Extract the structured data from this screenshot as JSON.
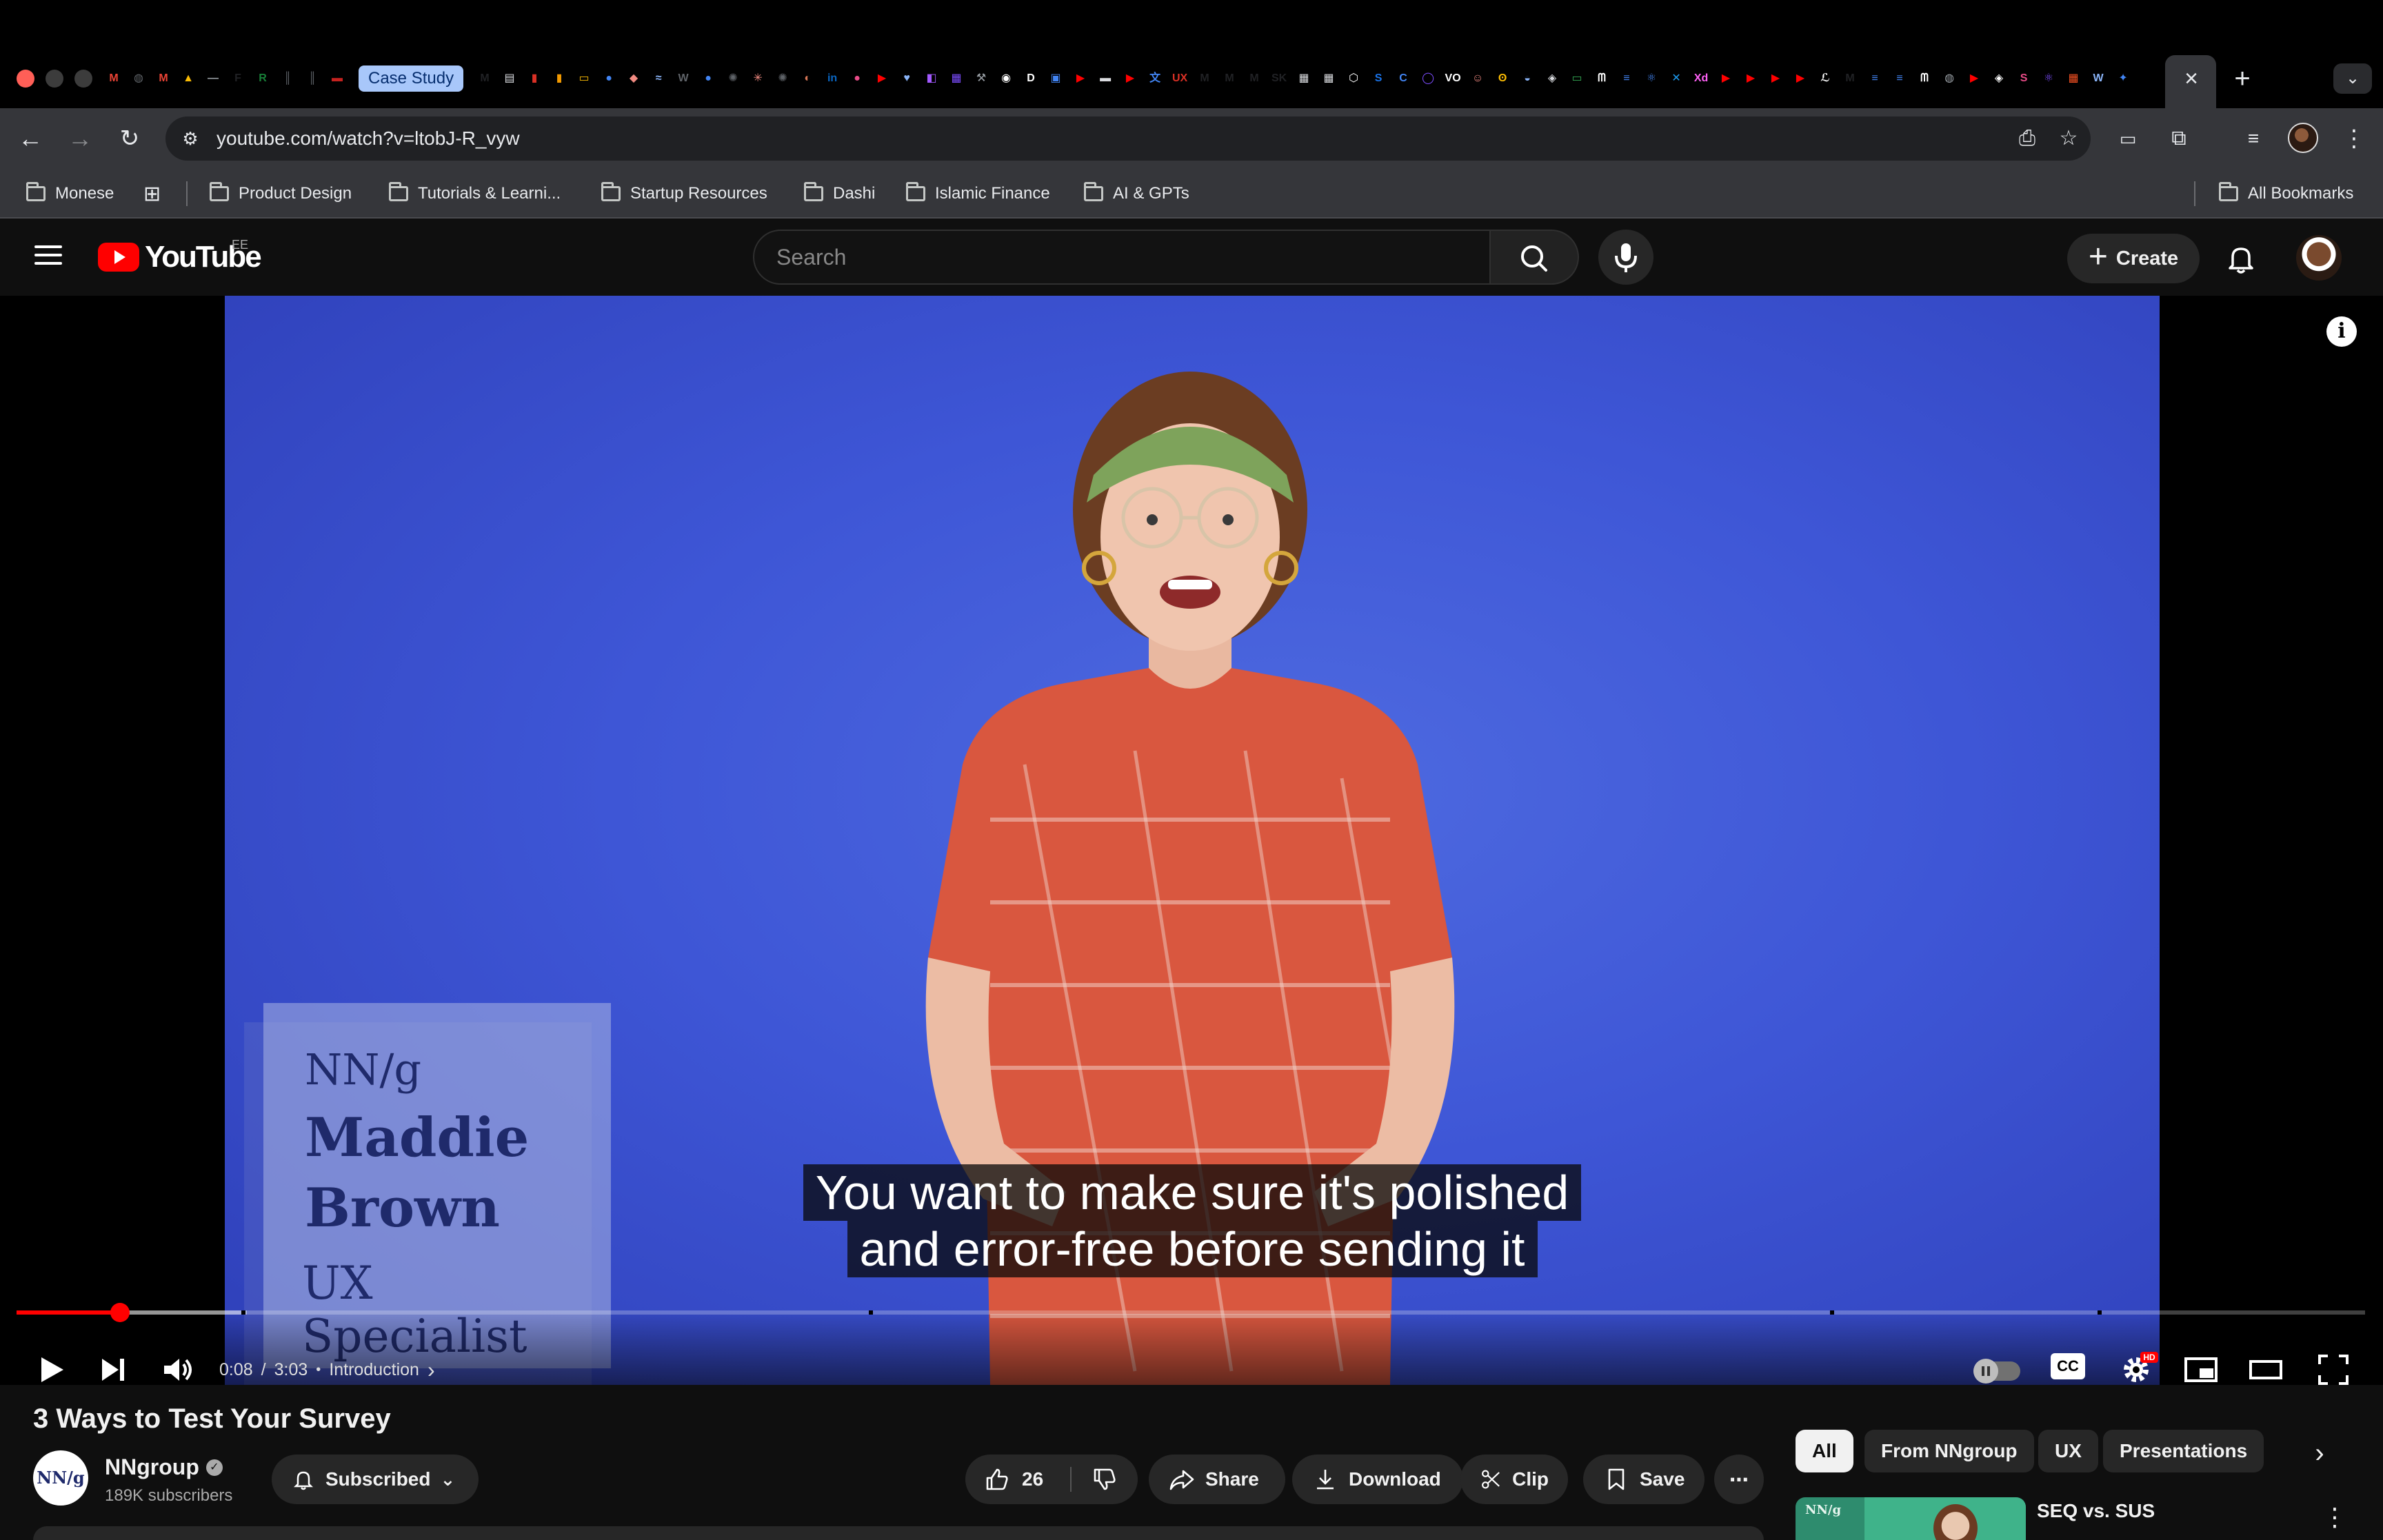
{
  "browser": {
    "tab_pill_label": "Case Study",
    "url": "youtube.com/watch?v=ltobJ-R_vyw",
    "favicons": [
      {
        "icon": "gmail-icon",
        "glyph": "M",
        "color": "#ea4335"
      },
      {
        "icon": "globe-icon",
        "glyph": "◍",
        "color": "#5f6368"
      },
      {
        "icon": "gmail-icon",
        "glyph": "M",
        "color": "#ea4335"
      },
      {
        "icon": "drive-icon",
        "glyph": "▲",
        "color": "#fbbc04"
      },
      {
        "icon": "dash-icon",
        "glyph": "—",
        "color": "#9aa0a6"
      },
      {
        "icon": "f-icon",
        "glyph": "F",
        "color": "#202124"
      },
      {
        "icon": "r-icon",
        "glyph": "R",
        "color": "#188038"
      },
      {
        "icon": "bars-icon",
        "glyph": "║",
        "color": "#5f6368"
      },
      {
        "icon": "bars-icon",
        "glyph": "║",
        "color": "#5f6368"
      },
      {
        "icon": "flag-icon",
        "glyph": "▬",
        "color": "#c5221f"
      }
    ],
    "favicons_after": [
      {
        "icon": "medium-icon",
        "glyph": "M",
        "color": "#202124"
      },
      {
        "icon": "doc-icon",
        "glyph": "▤",
        "color": "#dadce0"
      },
      {
        "icon": "red-doc-icon",
        "glyph": "▮",
        "color": "#d93025"
      },
      {
        "icon": "book-icon",
        "glyph": "▮",
        "color": "#f29900"
      },
      {
        "icon": "slides-icon",
        "glyph": "▭",
        "color": "#fbbc04"
      },
      {
        "icon": "dot-icon",
        "glyph": "●",
        "color": "#4285f4"
      },
      {
        "icon": "arc-icon",
        "glyph": "◆",
        "color": "#f28b82"
      },
      {
        "icon": "wave-icon",
        "glyph": "≈",
        "color": "#8ab4f8"
      },
      {
        "icon": "wikipedia-icon",
        "glyph": "W",
        "color": "#5f6368"
      },
      {
        "icon": "dot-icon",
        "glyph": "●",
        "color": "#4285f4"
      },
      {
        "icon": "openai-icon",
        "glyph": "✺",
        "color": "#5f6368"
      },
      {
        "icon": "spark-icon",
        "glyph": "✳",
        "color": "#f28b82"
      },
      {
        "icon": "openai-icon",
        "glyph": "✺",
        "color": "#5f6368"
      },
      {
        "icon": "claude-icon",
        "glyph": "◐",
        "color": "#d97757"
      },
      {
        "icon": "linkedin-icon",
        "glyph": "in",
        "color": "#0a66c2"
      },
      {
        "icon": "dribbble-icon",
        "glyph": "●",
        "color": "#ea4c89"
      },
      {
        "icon": "youtube-icon",
        "glyph": "▶",
        "color": "#ff0000"
      },
      {
        "icon": "heart-icon",
        "glyph": "♥",
        "color": "#8ab4f8"
      },
      {
        "icon": "figma-icon",
        "glyph": "◧",
        "color": "#a259ff"
      },
      {
        "icon": "image-icon",
        "glyph": "▦",
        "color": "#7c4dff"
      },
      {
        "icon": "tool-icon",
        "glyph": "⚒",
        "color": "#9aa0a6"
      },
      {
        "icon": "github-icon",
        "glyph": "◉",
        "color": "#ffffff"
      },
      {
        "icon": "d-icon",
        "glyph": "D",
        "color": "#ffffff"
      },
      {
        "icon": "calendar-icon",
        "glyph": "▣",
        "color": "#4285f4"
      },
      {
        "icon": "youtube-icon",
        "glyph": "▶",
        "color": "#ff0000"
      },
      {
        "icon": "card-icon",
        "glyph": "▬",
        "color": "#dadce0"
      },
      {
        "icon": "youtube-icon",
        "glyph": "▶",
        "color": "#ff0000"
      },
      {
        "icon": "translate-icon",
        "glyph": "文",
        "color": "#4285f4"
      },
      {
        "icon": "ux-icon",
        "glyph": "UX",
        "color": "#d93025"
      },
      {
        "icon": "medium-icon",
        "glyph": "M",
        "color": "#202124"
      },
      {
        "icon": "medium-icon",
        "glyph": "M",
        "color": "#202124"
      },
      {
        "icon": "medium-icon",
        "glyph": "M",
        "color": "#202124"
      },
      {
        "icon": "sk-icon",
        "glyph": "SK",
        "color": "#202124"
      },
      {
        "icon": "image-icon",
        "glyph": "▦",
        "color": "#dadce0"
      },
      {
        "icon": "image-icon",
        "glyph": "▦",
        "color": "#dadce0"
      },
      {
        "icon": "box-icon",
        "glyph": "⬡",
        "color": "#ffffff"
      },
      {
        "icon": "s-icon",
        "glyph": "S",
        "color": "#1a73e8"
      },
      {
        "icon": "c-icon",
        "glyph": "C",
        "color": "#4285f4"
      },
      {
        "icon": "ring-icon",
        "glyph": "◯",
        "color": "#7c4dff"
      },
      {
        "icon": "vo-icon",
        "glyph": "VO",
        "color": "#ffffff"
      },
      {
        "icon": "face-icon",
        "glyph": "☺",
        "color": "#f28b82"
      },
      {
        "icon": "owl-icon",
        "glyph": "ʘ",
        "color": "#fbbc04"
      },
      {
        "icon": "swirl-icon",
        "glyph": "◒",
        "color": "#8ab4f8"
      },
      {
        "icon": "diamond-icon",
        "glyph": "◈",
        "color": "#dadce0"
      },
      {
        "icon": "battery-icon",
        "glyph": "▭",
        "color": "#34a853"
      },
      {
        "icon": "signature-icon",
        "glyph": "ᗰ",
        "color": "#ffffff"
      },
      {
        "icon": "stack-icon",
        "glyph": "≡",
        "color": "#4285f4"
      },
      {
        "icon": "atom-icon",
        "glyph": "⚛",
        "color": "#4285f4"
      },
      {
        "icon": "twitter-icon",
        "glyph": "✕",
        "color": "#1d9bf0"
      },
      {
        "icon": "xd-icon",
        "glyph": "Xd",
        "color": "#ff61f6"
      },
      {
        "icon": "youtube-icon",
        "glyph": "▶",
        "color": "#ff0000"
      },
      {
        "icon": "youtube-icon",
        "glyph": "▶",
        "color": "#ff0000"
      },
      {
        "icon": "youtube-icon",
        "glyph": "▶",
        "color": "#ff0000"
      },
      {
        "icon": "youtube-icon",
        "glyph": "▶",
        "color": "#ff0000"
      },
      {
        "icon": "signature-icon",
        "glyph": "ℒ",
        "color": "#ffffff"
      },
      {
        "icon": "medium-icon",
        "glyph": "M",
        "color": "#202124"
      },
      {
        "icon": "stack-icon",
        "glyph": "≡",
        "color": "#4285f4"
      },
      {
        "icon": "stack-icon",
        "glyph": "≡",
        "color": "#4285f4"
      },
      {
        "icon": "signature-icon",
        "glyph": "ᗰ",
        "color": "#ffffff"
      },
      {
        "icon": "globe-icon",
        "glyph": "◍",
        "color": "#9aa0a6"
      },
      {
        "icon": "youtube-icon",
        "glyph": "▶",
        "color": "#ff0000"
      },
      {
        "icon": "diamond-icon",
        "glyph": "◈",
        "color": "#ffffff"
      },
      {
        "icon": "s-icon",
        "glyph": "S",
        "color": "#ea4c89"
      },
      {
        "icon": "atom-icon",
        "glyph": "⚛",
        "color": "#7c4dff"
      },
      {
        "icon": "microsoft-icon",
        "glyph": "▦",
        "color": "#f25022"
      },
      {
        "icon": "w-icon",
        "glyph": "W",
        "color": "#8ab4f8"
      },
      {
        "icon": "sparkle-icon",
        "glyph": "✦",
        "color": "#4285f4"
      }
    ]
  },
  "bookmarks": [
    {
      "label": "Monese",
      "icon": "bookmark-folder-icon"
    },
    {
      "label": "Product Design",
      "icon": "folder-icon"
    },
    {
      "label": "Tutorials & Learni...",
      "icon": "folder-icon"
    },
    {
      "label": "Startup Resources",
      "icon": "folder-icon"
    },
    {
      "label": "Dashi",
      "icon": "folder-icon"
    },
    {
      "label": "Islamic Finance",
      "icon": "folder-icon"
    },
    {
      "label": "AI & GPTs",
      "icon": "folder-icon"
    }
  ],
  "all_bookmarks_label": "All Bookmarks",
  "youtube": {
    "logo_text": "YouTube",
    "country_code": "EE",
    "search_placeholder": "Search",
    "create_label": "Create"
  },
  "player": {
    "lower_third": {
      "logo": "NN/g",
      "name_line1": "Maddie",
      "name_line2": "Brown",
      "role": "UX Specialist"
    },
    "caption_line1": "You want to make sure it's polished",
    "caption_line2": "and error-free before sending it",
    "time_current": "0:08",
    "time_total": "3:03",
    "time_separator": "/",
    "chapter_dot": "•",
    "chapter": "Introduction",
    "progress_played_fraction": 0.044,
    "progress_buffered_fraction": 0.098,
    "cc_label": "CC",
    "hd_badge": "HD",
    "info_glyph": "i"
  },
  "video": {
    "title": "3 Ways to Test Your Survey",
    "channel_name": "NNgroup",
    "channel_avatar_text": "NN/g",
    "verified_glyph": "✓",
    "subscribers": "189K subscribers",
    "subscribed_label": "Subscribed",
    "like_count": "26",
    "share_label": "Share",
    "download_label": "Download",
    "clip_label": "Clip",
    "save_label": "Save",
    "more_glyph": "⋯"
  },
  "sidebar": {
    "chips": [
      "All",
      "From NNgroup",
      "UX",
      "Presentations"
    ],
    "chip_next_glyph": "›",
    "recommended": [
      {
        "title": "SEQ vs. SUS",
        "thumb_logo": "NN/g"
      }
    ],
    "menu_glyph": "⋮"
  }
}
